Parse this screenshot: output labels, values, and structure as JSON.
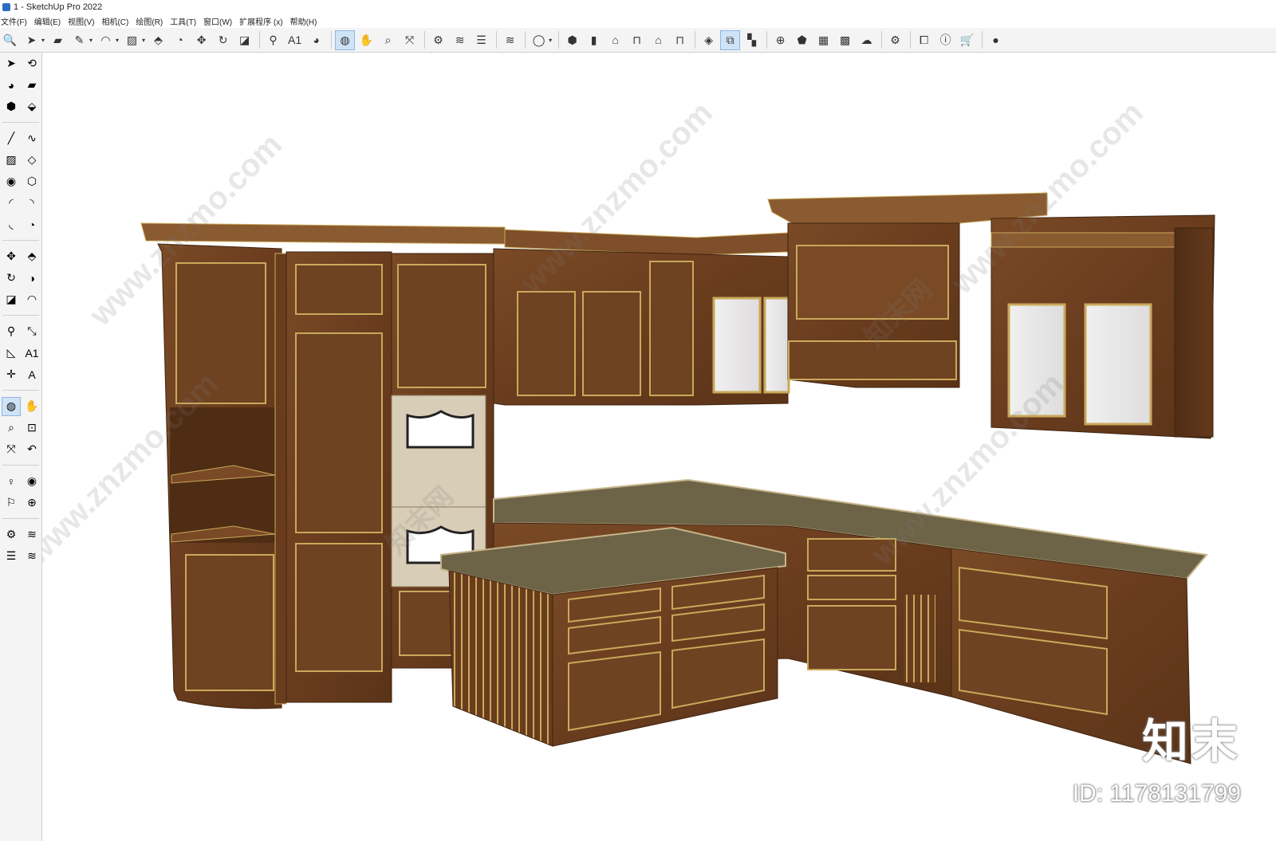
{
  "window": {
    "title": "1 - SketchUp Pro 2022"
  },
  "menu": [
    "文件(F)",
    "编辑(E)",
    "视图(V)",
    "相机(C)",
    "绘图(R)",
    "工具(T)",
    "窗口(W)",
    "扩展程序 (x)",
    "帮助(H)"
  ],
  "toolbar": {
    "items": [
      {
        "name": "search-icon",
        "glyph": "🔍"
      },
      {
        "name": "select-tool-icon",
        "glyph": "➤",
        "dropdown": true
      },
      {
        "name": "eraser-icon",
        "glyph": "▰"
      },
      {
        "name": "pencil-icon",
        "glyph": "✎",
        "dropdown": true
      },
      {
        "name": "arc-icon",
        "glyph": "◠",
        "dropdown": true
      },
      {
        "name": "rectangle-icon",
        "glyph": "▨",
        "dropdown": true
      },
      {
        "name": "push-pull-icon",
        "glyph": "⬘"
      },
      {
        "name": "follow-me-icon",
        "glyph": "◔"
      },
      {
        "name": "move-icon",
        "glyph": "✥"
      },
      {
        "name": "rotate-icon",
        "glyph": "↻"
      },
      {
        "name": "scale-icon",
        "glyph": "◪"
      },
      {
        "name": "sep"
      },
      {
        "name": "tape-measure-icon",
        "glyph": "⚲"
      },
      {
        "name": "text-icon",
        "glyph": "A1"
      },
      {
        "name": "paint-bucket-icon",
        "glyph": "◕"
      },
      {
        "name": "sep"
      },
      {
        "name": "orbit-icon",
        "glyph": "◍",
        "active": true
      },
      {
        "name": "pan-icon",
        "glyph": "✋"
      },
      {
        "name": "zoom-icon",
        "glyph": "⌕"
      },
      {
        "name": "zoom-extents-icon",
        "glyph": "⤧"
      },
      {
        "name": "sep"
      },
      {
        "name": "3d-warehouse-icon",
        "glyph": "⚙"
      },
      {
        "name": "extension-warehouse-icon",
        "glyph": "≋"
      },
      {
        "name": "layout-icon",
        "glyph": "☰"
      },
      {
        "name": "sep"
      },
      {
        "name": "extension-manager-icon",
        "glyph": "≋"
      },
      {
        "name": "sep"
      },
      {
        "name": "account-icon",
        "glyph": "◯",
        "dropdown": true
      },
      {
        "name": "sep"
      },
      {
        "name": "iso-view-icon",
        "glyph": "⬢"
      },
      {
        "name": "top-view-icon",
        "glyph": "▮"
      },
      {
        "name": "front-view-icon",
        "glyph": "⌂"
      },
      {
        "name": "right-view-icon",
        "glyph": "⊓"
      },
      {
        "name": "back-view-icon",
        "glyph": "⌂"
      },
      {
        "name": "left-view-icon",
        "glyph": "⊓"
      },
      {
        "name": "sep"
      },
      {
        "name": "section-plane-icon",
        "glyph": "◈"
      },
      {
        "name": "display-section-icon",
        "glyph": "⧉",
        "active": true
      },
      {
        "name": "section-fill-icon",
        "glyph": "▚"
      },
      {
        "name": "sep"
      },
      {
        "name": "add-location-icon",
        "glyph": "⊕"
      },
      {
        "name": "shadows-icon",
        "glyph": "⬟"
      },
      {
        "name": "styles-icon",
        "glyph": "▦"
      },
      {
        "name": "fog-icon",
        "glyph": "▩"
      },
      {
        "name": "cloud-icon",
        "glyph": "☁"
      },
      {
        "name": "sep"
      },
      {
        "name": "settings-icon",
        "glyph": "⚙"
      },
      {
        "name": "sep"
      },
      {
        "name": "outliner-icon",
        "glyph": "⧠"
      },
      {
        "name": "info-icon",
        "glyph": "ⓘ"
      },
      {
        "name": "cart-icon",
        "glyph": "🛒"
      },
      {
        "name": "sep"
      },
      {
        "name": "user-icon",
        "glyph": "●"
      }
    ]
  },
  "left_toolbar": {
    "groups": [
      [
        [
          "select-icon",
          "➤"
        ],
        [
          "orbit-icon",
          "⟲"
        ]
      ],
      [
        [
          "paint-icon",
          "◕"
        ],
        [
          "eraser-icon",
          "▰"
        ]
      ],
      [
        [
          "component-icon",
          "⬢"
        ],
        [
          "tag-icon",
          "⬙"
        ]
      ],
      "gap",
      [
        [
          "line-icon",
          "╱"
        ],
        [
          "freehand-icon",
          "∿"
        ]
      ],
      [
        [
          "rectangle-icon",
          "▨"
        ],
        [
          "rotated-rectangle-icon",
          "◇"
        ]
      ],
      [
        [
          "circle-icon",
          "◉"
        ],
        [
          "polygon-icon",
          "⬡"
        ]
      ],
      [
        [
          "arc-icon",
          "◜"
        ],
        [
          "2-point-arc-icon",
          "◝"
        ]
      ],
      [
        [
          "3-point-arc-icon",
          "◟"
        ],
        [
          "pie-icon",
          "◔"
        ]
      ],
      "gap",
      [
        [
          "move-icon",
          "✥"
        ],
        [
          "push-pull-icon",
          "⬘"
        ]
      ],
      [
        [
          "rotate-icon",
          "↻"
        ],
        [
          "follow-me-icon",
          "◑"
        ]
      ],
      [
        [
          "scale-icon",
          "◪"
        ],
        [
          "offset-icon",
          "◠"
        ]
      ],
      "gap",
      [
        [
          "tape-measure-icon",
          "⚲"
        ],
        [
          "dimension-icon",
          "⤡"
        ]
      ],
      [
        [
          "protractor-icon",
          "◺"
        ],
        [
          "text-icon",
          "A1"
        ]
      ],
      [
        [
          "axes-icon",
          "✛"
        ],
        [
          "3d-text-icon",
          "A"
        ]
      ],
      "gap",
      [
        [
          "orbit-active-icon",
          "◍",
          true
        ],
        [
          "pan-icon",
          "✋"
        ]
      ],
      [
        [
          "zoom-icon",
          "⌕"
        ],
        [
          "zoom-window-icon",
          "⊡"
        ]
      ],
      [
        [
          "zoom-extents-icon",
          "⤧"
        ],
        [
          "previous-view-icon",
          "↶"
        ]
      ],
      "gap",
      [
        [
          "position-camera-icon",
          "♀"
        ],
        [
          "look-around-icon",
          "◉"
        ]
      ],
      [
        [
          "walk-icon",
          "⚐"
        ],
        [
          "section-plane-icon",
          "⊕"
        ]
      ],
      "gap",
      [
        [
          "warehouse-icon",
          "⚙"
        ],
        [
          "extension-icon",
          "≋"
        ]
      ],
      [
        [
          "layout-icon",
          "☰"
        ],
        [
          "ext-manager-icon",
          "≋"
        ]
      ]
    ]
  },
  "watermark": {
    "site": "www.znzmo.com",
    "cn": "知末网",
    "brand": "知末",
    "id": "ID: 1178131799"
  },
  "colors": {
    "wood_dark": "#5a3418",
    "wood_mid": "#7a4a26",
    "wood_light": "#8f5a30",
    "gold": "#c9a95a",
    "countertop": "#6d6448",
    "counter_edge": "#c8b58a",
    "glass": "#ecebeb",
    "oven": "#d8cdb6"
  }
}
